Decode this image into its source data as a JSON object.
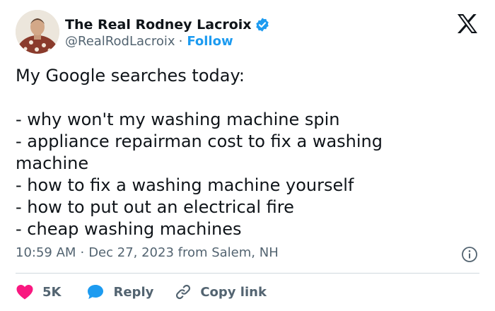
{
  "author": {
    "display_name": "The Real Rodney Lacroix",
    "handle": "@RealRodLacroix",
    "separator": "·",
    "follow_label": "Follow"
  },
  "tweet": {
    "lines": [
      "My Google searches today:",
      "",
      "- why won't my washing machine spin",
      "- appliance repairman cost to fix a washing",
      "machine",
      "- how to fix a washing machine yourself",
      "- how to put out an electrical fire",
      "- cheap washing machines"
    ]
  },
  "meta": {
    "time": "10:59 AM",
    "separator": "·",
    "date_location": "Dec 27, 2023 from Salem, NH"
  },
  "actions": {
    "like_count": "5K",
    "reply_label": "Reply",
    "copy_link_label": "Copy link"
  },
  "icons": {
    "verified": "verified-badge-icon",
    "platform": "x-logo-icon",
    "info": "info-icon",
    "like": "heart-icon",
    "reply": "speech-bubble-icon",
    "copy": "link-icon"
  },
  "colors": {
    "accent": "#1d9bf0",
    "like": "#f91880",
    "text": "#0f1419",
    "secondary": "#536471"
  }
}
